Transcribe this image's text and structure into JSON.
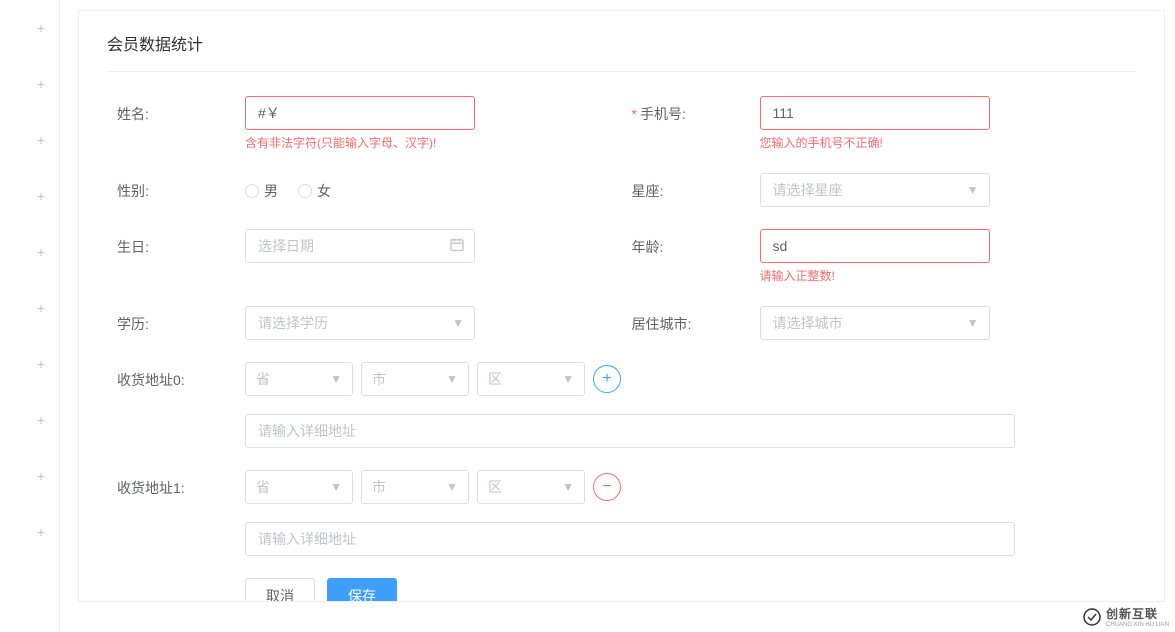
{
  "topbar": {
    "tabs_left_hidden": "——",
    "tabs": [
      "",
      "……",
      "……",
      "……",
      "……"
    ],
    "right": [
      "……",
      "……"
    ]
  },
  "sidebar": {
    "plus": "+"
  },
  "title": "会员数据统计",
  "form": {
    "name": {
      "label": "姓名:",
      "placeholder": "#￥",
      "value": "#￥",
      "error": "含有非法字符(只能输入字母、汉字)!"
    },
    "phone": {
      "label": "手机号:",
      "required": "*",
      "value": "111",
      "error": "您输入的手机号不正确!"
    },
    "gender": {
      "label": "性别:",
      "options": [
        "男",
        "女"
      ]
    },
    "zodiac": {
      "label": "星座:",
      "placeholder": "请选择星座"
    },
    "birthday": {
      "label": "生日:",
      "placeholder": "选择日期"
    },
    "age": {
      "label": "年龄:",
      "value": "sd",
      "error": "请输入正整数!"
    },
    "education": {
      "label": "学历:",
      "placeholder": "请选择学历"
    },
    "city": {
      "label": "居住城市:",
      "placeholder": "请选择城市"
    },
    "addr0": {
      "label": "收货地址0:",
      "province": "省",
      "city": "市",
      "district": "区",
      "detail_placeholder": "请输入详细地址"
    },
    "addr1": {
      "label": "收货地址1:",
      "province": "省",
      "city": "市",
      "district": "区",
      "detail_placeholder": "请输入详细地址"
    }
  },
  "actions": {
    "cancel": "取消",
    "save": "保存"
  },
  "watermark": {
    "main": "创新互联",
    "sub": "CHUANG XIN HU LIAN"
  }
}
